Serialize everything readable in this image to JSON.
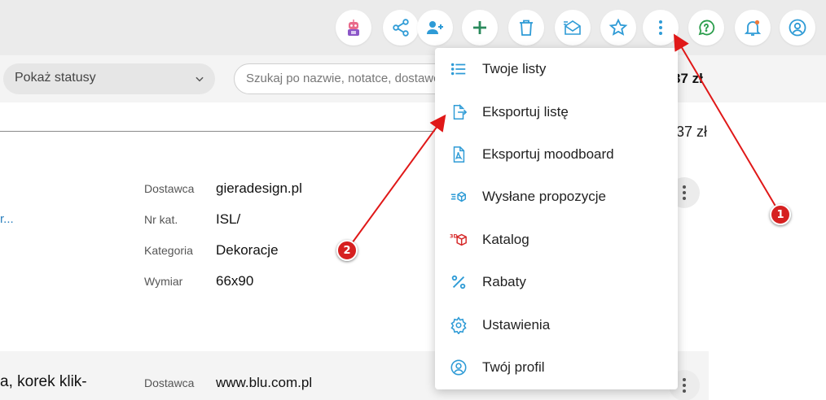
{
  "toolbar": {
    "buttons": [
      {
        "name": "robot-avatar-icon"
      },
      {
        "name": "share-icon"
      },
      {
        "name": "add-user-icon"
      },
      {
        "name": "plus-icon"
      },
      {
        "name": "trash-icon"
      },
      {
        "name": "send-mail-icon"
      },
      {
        "name": "star-icon"
      },
      {
        "name": "kebab-menu-icon"
      },
      {
        "name": "whatsapp-icon"
      },
      {
        "name": "bell-icon"
      },
      {
        "name": "profile-icon"
      }
    ],
    "accent_color": "#2e9bd6",
    "green_color": "#2a9d4b"
  },
  "filters": {
    "status_select": "Pokaż statusy",
    "search_placeholder": "Szukaj po nazwie, notatce, dostawcy..."
  },
  "totals": {
    "top": "37 zł",
    "mid": "37 zł"
  },
  "product1": {
    "title_trunc": "r...",
    "fields": [
      {
        "label": "Dostawca",
        "value": "gieradesign.pl"
      },
      {
        "label": "Nr kat.",
        "value": "ISL/"
      },
      {
        "label": "Kategoria",
        "value": "Dekoracje"
      },
      {
        "label": "Wymiar",
        "value": "66x90"
      }
    ]
  },
  "product2": {
    "title_trunc": "a, korek klik-",
    "fields": [
      {
        "label": "Dostawca",
        "value": "www.blu.com.pl"
      }
    ]
  },
  "menu": {
    "items": [
      {
        "label": "Twoje listy",
        "icon": "list-icon"
      },
      {
        "label": "Eksportuj listę",
        "icon": "export-icon"
      },
      {
        "label": "Eksportuj moodboard",
        "icon": "pdf-icon"
      },
      {
        "label": "Wysłane propozycje",
        "icon": "sent-box-icon"
      },
      {
        "label": "Katalog",
        "icon": "3d-box-icon"
      },
      {
        "label": "Rabaty",
        "icon": "percent-icon"
      },
      {
        "label": "Ustawienia",
        "icon": "gear-icon"
      },
      {
        "label": "Twój profil",
        "icon": "user-circle-icon"
      }
    ]
  },
  "annotations": [
    {
      "number": "1"
    },
    {
      "number": "2"
    }
  ]
}
